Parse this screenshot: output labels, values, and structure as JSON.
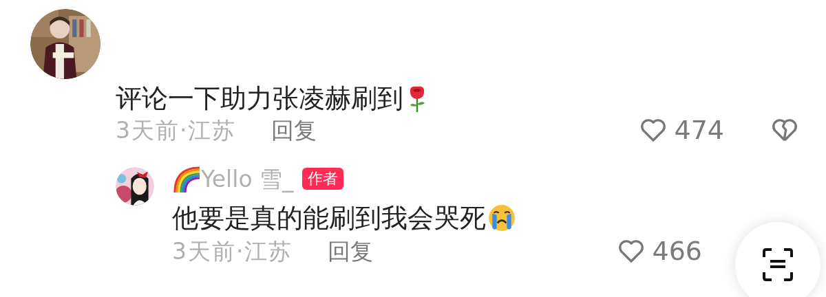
{
  "comment": {
    "text": "评论一下助力张凌赫刷到",
    "emoji": {
      "kind": "rose"
    },
    "time_location": "3天前·江苏",
    "reply_label": "回复",
    "likes": "474",
    "liked": false
  },
  "reply": {
    "name_emoji": {
      "kind": "rainbow"
    },
    "author_name": "Yello 雪_",
    "badge": "作者",
    "text": "他要是真的能刷到我会哭死",
    "emoji": {
      "kind": "crying"
    },
    "time_location": "3天前·江苏",
    "reply_label": "回复",
    "likes": "466",
    "liked": false
  }
}
